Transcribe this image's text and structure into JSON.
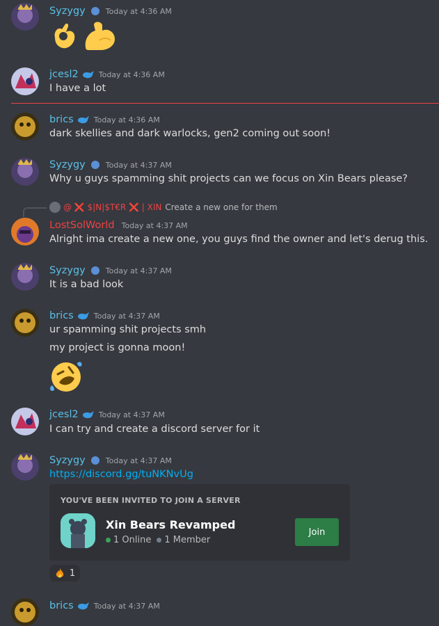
{
  "colors": {
    "background": "#36393f",
    "name_blue": "#5bc0e8",
    "name_red": "#ed4245",
    "timestamp": "#a3a6aa",
    "link": "#00aff4",
    "join_green": "#2d7d46",
    "divider_red": "#ed4245"
  },
  "messages": [
    {
      "author": "Syzygy",
      "time": "Today at 4:36 AM",
      "lines": [],
      "emoji": [
        "ok-hand",
        "flexed-biceps"
      ]
    },
    {
      "author": "jcesl2",
      "time": "Today at 4:36 AM",
      "lines": [
        "I have a lot"
      ]
    },
    {
      "author": "brics",
      "time": "Today at 4:36 AM",
      "lines": [
        "dark skellies and dark warlocks, gen2 coming out soon!"
      ]
    },
    {
      "author": "Syzygy",
      "time": "Today at 4:37 AM",
      "lines": [
        "Why u guys spamming shit projects can we focus on Xin Bears please?"
      ]
    },
    {
      "author": "LostSolWorld",
      "time": "Today at 4:37 AM",
      "lines": [
        "Alright ima create a new one, you guys find the owner and let's derug this."
      ],
      "reply": {
        "mention": "@ ❌ $|N|$T€R ❌ | XIN",
        "text": "Create a new one for them"
      }
    },
    {
      "author": "Syzygy",
      "time": "Today at 4:37 AM",
      "lines": [
        "It is a bad look"
      ]
    },
    {
      "author": "brics",
      "time": "Today at 4:37 AM",
      "lines": [
        "ur spamming shit projects smh",
        "my project is gonna moon!"
      ],
      "emoji": [
        "rolling-on-floor-laughing"
      ]
    },
    {
      "author": "jcesl2",
      "time": "Today at 4:37 AM",
      "lines": [
        "I can try and create a discord server for it"
      ]
    },
    {
      "author": "Syzygy",
      "time": "Today at 4:37 AM",
      "link": "https://discord.gg/tuNKNvUg",
      "invite": {
        "header": "YOU'VE BEEN INVITED TO JOIN A SERVER",
        "server_name": "Xin Bears Revamped",
        "online": "1 Online",
        "members": "1 Member",
        "join_label": "Join"
      },
      "reaction": {
        "emoji": "fire",
        "count": "1"
      }
    },
    {
      "author": "brics",
      "time": "Today at 4:37 AM",
      "lines": []
    }
  ]
}
